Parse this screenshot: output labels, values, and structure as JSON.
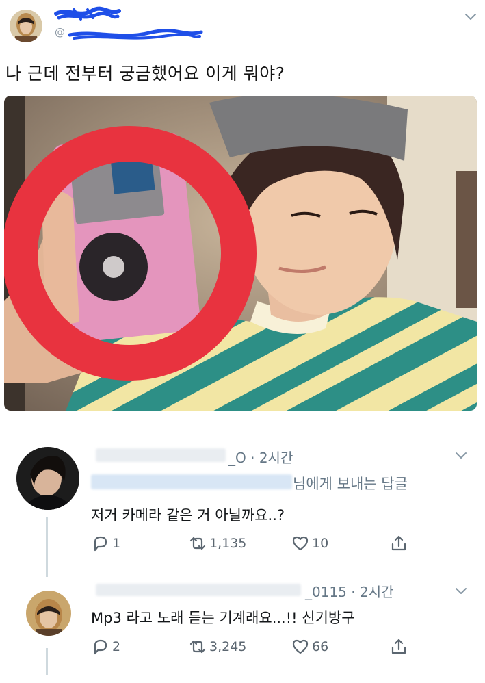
{
  "tweet": {
    "handle_prefix": "@",
    "text": "나 근데 전부터 궁금했어요 이게 뭐야?"
  },
  "replies": [
    {
      "handle_suffix": "_O",
      "time": "2시간",
      "replying_text": "님에게 보내는 답글",
      "text": "저거 카메라 같은 거 아닐까요..?",
      "reply_count": "1",
      "retweet_count": "1,135",
      "like_count": "10"
    },
    {
      "handle_suffix": "_0115",
      "time": "2시간",
      "text": "Mp3 라고 노래 듣는 기계래요...!! 신기방구",
      "reply_count": "2",
      "retweet_count": "3,245",
      "like_count": "66"
    }
  ],
  "colors": {
    "link": "#1da1f2",
    "scribble": "#1f4fe8",
    "red_circle": "#e8333f",
    "muted": "#657786"
  },
  "icons": [
    "chevron-down-icon",
    "reply-icon",
    "retweet-icon",
    "heart-icon",
    "share-icon"
  ]
}
